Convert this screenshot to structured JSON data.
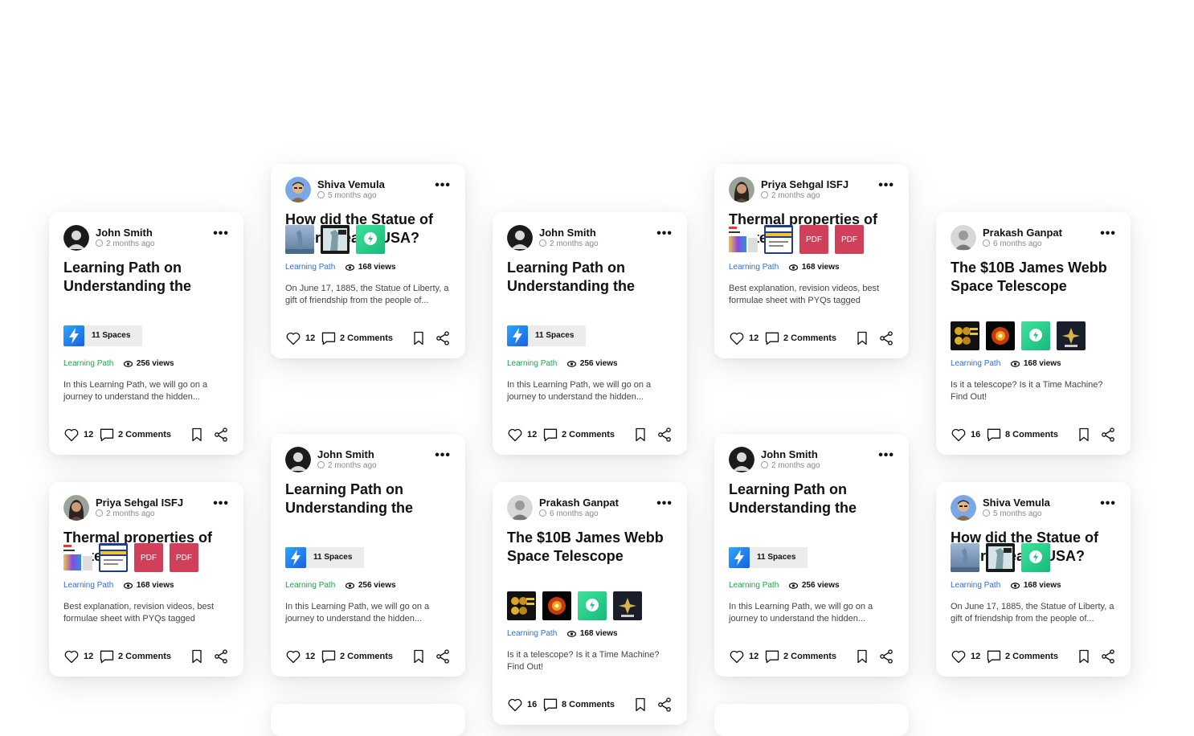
{
  "cards": [
    {
      "author": "John Smith",
      "time": "2 months ago",
      "title": "Learning Path on Understanding the",
      "spaces": "11 Spaces",
      "type": "Learning Path",
      "views": "256 views",
      "desc": "In this Learning Path, we will go on a journey to understand the hidden...",
      "likes": "12",
      "comments": "2 Comments"
    },
    {
      "author": "Shiva Vemula",
      "time": "5 months ago",
      "title": "How did the Statue of Liberty reach USA?",
      "type": "Learning Path",
      "views": "168 views",
      "desc": "On June 17, 1885, the Statue of Liberty, a gift of friendship from the people of...",
      "likes": "12",
      "comments": "2 Comments"
    },
    {
      "author": "John Smith",
      "time": "2 months ago",
      "title": "Learning Path on Understanding the",
      "spaces": "11 Spaces",
      "type": "Learning Path",
      "views": "256 views",
      "desc": "In this Learning Path, we will go on a journey to understand the hidden...",
      "likes": "12",
      "comments": "2 Comments"
    },
    {
      "author": "Priya Sehgal ISFJ",
      "time": "2 months ago",
      "title": "Thermal properties of matter",
      "pdf": "PDF",
      "type": "Learning Path",
      "views": "168 views",
      "desc": "Best explanation, revision videos, best formulae sheet with PYQs tagged",
      "likes": "12",
      "comments": "2 Comments"
    },
    {
      "author": "Prakash Ganpat",
      "time": "6 months ago",
      "title": "The $10B James Webb Space Telescope",
      "type": "Learning Path",
      "views": "168 views",
      "desc": "Is it a telescope? Is it a Time Machine? Find Out!",
      "likes": "16",
      "comments": "8 Comments"
    },
    {
      "author": "Priya Sehgal ISFJ",
      "time": "2 months ago",
      "title": "Thermal properties of matter",
      "pdf": "PDF",
      "type": "Learning Path",
      "views": "168 views",
      "desc": "Best explanation, revision videos, best formulae sheet with PYQs tagged",
      "likes": "12",
      "comments": "2 Comments"
    },
    {
      "author": "John Smith",
      "time": "2 months ago",
      "title": "Learning Path on Understanding the",
      "spaces": "11 Spaces",
      "type": "Learning Path",
      "views": "256 views",
      "desc": "In this Learning Path, we will go on a journey to understand the hidden...",
      "likes": "12",
      "comments": "2 Comments"
    },
    {
      "author": "Prakash Ganpat",
      "time": "6 months ago",
      "title": "The $10B James Webb Space Telescope",
      "type": "Learning Path",
      "views": "168 views",
      "desc": "Is it a telescope? Is it a Time Machine? Find Out!",
      "likes": "16",
      "comments": "8 Comments"
    },
    {
      "author": "John Smith",
      "time": "2 months ago",
      "title": "Learning Path on Understanding the",
      "spaces": "11 Spaces",
      "type": "Learning Path",
      "views": "256 views",
      "desc": "In this Learning Path, we will go on a journey to understand the hidden...",
      "likes": "12",
      "comments": "2 Comments"
    },
    {
      "author": "Shiva Vemula",
      "time": "5 months ago",
      "title": "How did the Statue of Liberty reach USA?",
      "type": "Learning Path",
      "views": "168 views",
      "desc": "On June 17, 1885, the Statue of Liberty, a gift of friendship from the people of...",
      "likes": "12",
      "comments": "2 Comments"
    }
  ],
  "colors": {
    "learning_path_green": "#1ba34d",
    "learning_path_blue": "#2c6fd6",
    "pdf_red": "#d0405a",
    "spaces_bg": "#ececec"
  },
  "icons": [
    "heart-icon",
    "comment-icon",
    "bookmark-icon",
    "share-icon",
    "more-icon",
    "eye-icon",
    "globe-icon",
    "lightning-icon"
  ]
}
